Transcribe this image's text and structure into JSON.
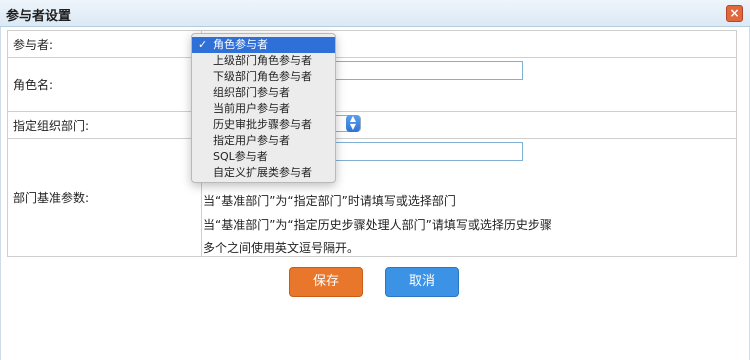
{
  "dialog": {
    "title": "参与者设置",
    "close_glyph": "×"
  },
  "form": {
    "participant_label": "参与者:",
    "role_name_label": "角色名:",
    "org_dept_label": "指定组织部门:",
    "dept_base_label": "部门基准参数:",
    "participant_selected": "角色参与者",
    "dept_base_hints": [
      "当“基准部门”为“指定部门”时请填写或选择部门",
      "当“基准部门”为“指定历史步骤处理人部门”请填写或选择历史步骤",
      "多个之间使用英文逗号隔开。"
    ]
  },
  "dropdown": {
    "check_glyph": "✓",
    "options": [
      "角色参与者",
      "上级部门角色参与者",
      "下级部门角色参与者",
      "组织部门参与者",
      "当前用户参与者",
      "历史审批步骤参与者",
      "指定用户参与者",
      "SQL参与者",
      "自定义扩展类参与者"
    ]
  },
  "buttons": {
    "save": "保存",
    "cancel": "取消"
  },
  "colors": {
    "save": "#e8762b",
    "cancel": "#3c93e6",
    "selected_option": "#2f6fd8"
  },
  "icons": {
    "close": "close-icon",
    "check": "check-icon",
    "stepper": "select-stepper-icon"
  }
}
